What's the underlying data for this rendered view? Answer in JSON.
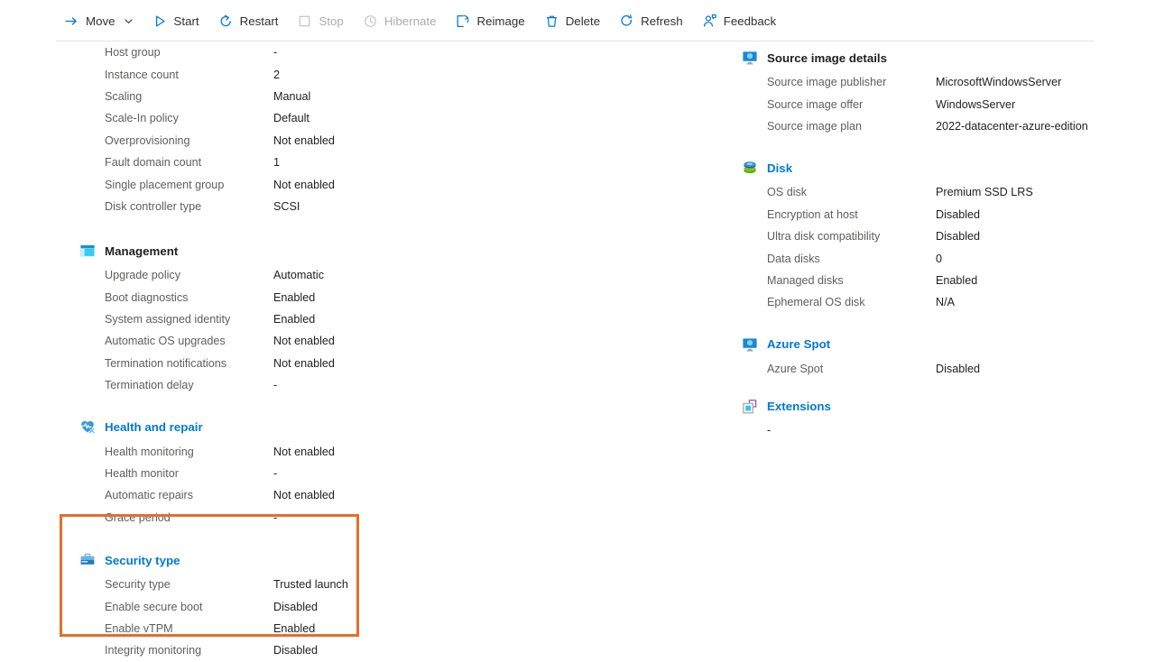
{
  "toolbar": {
    "items": [
      {
        "label": "Move",
        "icon": "move-arrow-icon",
        "disabled": false,
        "has_chevron": true
      },
      {
        "label": "Start",
        "icon": "play-triangle-icon",
        "disabled": false,
        "has_chevron": false
      },
      {
        "label": "Restart",
        "icon": "restart-arrow-icon",
        "disabled": false,
        "has_chevron": false
      },
      {
        "label": "Stop",
        "icon": "stop-square-icon",
        "disabled": true,
        "has_chevron": false
      },
      {
        "label": "Hibernate",
        "icon": "clock-icon",
        "disabled": true,
        "has_chevron": false
      },
      {
        "label": "Reimage",
        "icon": "reimage-icon",
        "disabled": false,
        "has_chevron": false
      },
      {
        "label": "Delete",
        "icon": "trash-icon",
        "disabled": false,
        "has_chevron": false
      },
      {
        "label": "Refresh",
        "icon": "refresh-circle-icon",
        "disabled": false,
        "has_chevron": false
      },
      {
        "label": "Feedback",
        "icon": "feedback-person-icon",
        "disabled": false,
        "has_chevron": false
      }
    ]
  },
  "colors": {
    "accent_blue": "#0078d4",
    "highlight_orange": "#e0712a",
    "label_gray": "#605e5c",
    "value_dark": "#201f1e",
    "disabled_gray": "#adadad"
  },
  "left_column": {
    "scale_set_rows": [
      {
        "label": "Host group",
        "value": "-"
      },
      {
        "label": "Instance count",
        "value": "2"
      },
      {
        "label": "Scaling",
        "value": "Manual"
      },
      {
        "label": "Scale-In policy",
        "value": "Default"
      },
      {
        "label": "Overprovisioning",
        "value": "Not enabled"
      },
      {
        "label": "Fault domain count",
        "value": "1"
      },
      {
        "label": "Single placement group",
        "value": "Not enabled"
      },
      {
        "label": "Disk controller type",
        "value": "SCSI"
      }
    ],
    "management": {
      "title": "Management",
      "icon": "management-window-icon",
      "rows": [
        {
          "label": "Upgrade policy",
          "value": "Automatic"
        },
        {
          "label": "Boot diagnostics",
          "value": "Enabled"
        },
        {
          "label": "System assigned identity",
          "value": "Enabled"
        },
        {
          "label": "Automatic OS upgrades",
          "value": "Not enabled"
        },
        {
          "label": "Termination notifications",
          "value": "Not enabled"
        },
        {
          "label": "Termination delay",
          "value": "-"
        }
      ]
    },
    "health_and_repair": {
      "title": "Health and repair",
      "icon": "heart-pulse-icon",
      "rows": [
        {
          "label": "Health monitoring",
          "value": "Not enabled"
        },
        {
          "label": "Health monitor",
          "value": "-"
        },
        {
          "label": "Automatic repairs",
          "value": "Not enabled"
        },
        {
          "label": "Grace period",
          "value": "-"
        }
      ]
    },
    "security_type": {
      "title": "Security type",
      "icon": "briefcase-icon",
      "highlighted": true,
      "rows": [
        {
          "label": "Security type",
          "value": "Trusted launch"
        },
        {
          "label": "Enable secure boot",
          "value": "Disabled"
        },
        {
          "label": "Enable vTPM",
          "value": "Enabled"
        },
        {
          "label": "Integrity monitoring",
          "value": "Disabled"
        }
      ]
    }
  },
  "right_column": {
    "source_image_details": {
      "title": "Source image details",
      "icon": "monitor-icon",
      "rows": [
        {
          "label": "Source image publisher",
          "value": "MicrosoftWindowsServer"
        },
        {
          "label": "Source image offer",
          "value": "WindowsServer"
        },
        {
          "label": "Source image plan",
          "value": "2022-datacenter-azure-edition"
        }
      ]
    },
    "disk": {
      "title": "Disk",
      "icon": "disk-stack-icon",
      "rows": [
        {
          "label": "OS disk",
          "value": "Premium SSD LRS"
        },
        {
          "label": "Encryption at host",
          "value": "Disabled"
        },
        {
          "label": "Ultra disk compatibility",
          "value": "Disabled"
        },
        {
          "label": "Data disks",
          "value": "0"
        },
        {
          "label": "Managed disks",
          "value": "Enabled"
        },
        {
          "label": "Ephemeral OS disk",
          "value": "N/A"
        }
      ]
    },
    "azure_spot": {
      "title": "Azure Spot",
      "icon": "monitor-icon",
      "rows": [
        {
          "label": "Azure Spot",
          "value": "Disabled"
        }
      ]
    },
    "extensions": {
      "title": "Extensions",
      "icon": "extensions-icon",
      "empty_value": "-"
    }
  }
}
